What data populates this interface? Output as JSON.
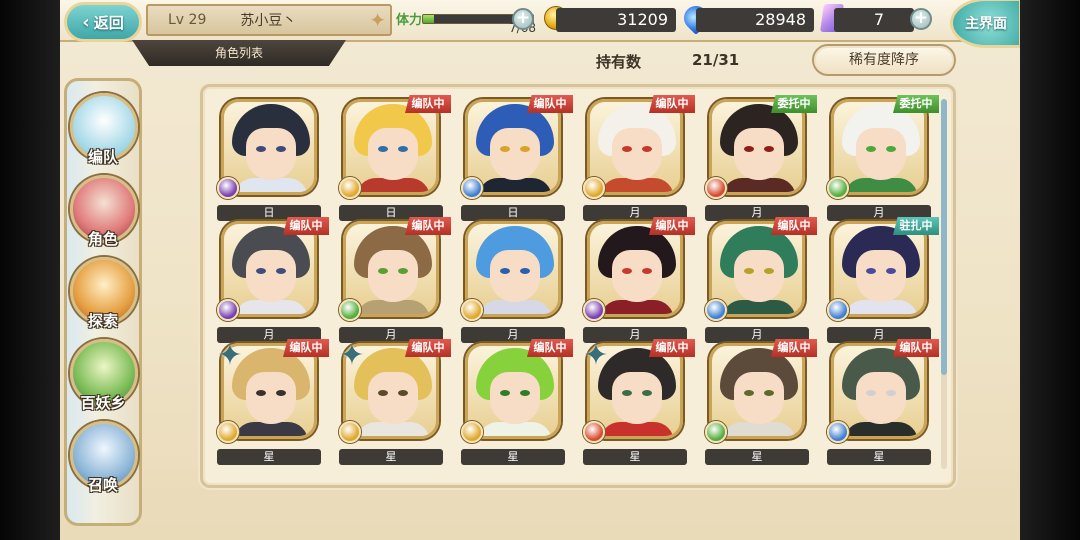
{
  "topbar": {
    "back_label": "返回",
    "level": "Lv 29",
    "player_name": "苏小豆丶",
    "stamina_label": "体力",
    "stamina_value": "7/68",
    "stamina_fraction": 0.103,
    "gold": "31209",
    "jade": "28948",
    "gems": "7",
    "main_label": "主界面"
  },
  "header": {
    "list_title": "角色列表",
    "owned_label": "持有数",
    "owned_count": "21/31",
    "sort_label": "稀有度降序"
  },
  "rail": [
    {
      "label": "编队",
      "icon": "ghost-team-icon"
    },
    {
      "label": "角色",
      "icon": "character-icon"
    },
    {
      "label": "探索",
      "icon": "map-scroll-icon"
    },
    {
      "label": "百妖乡",
      "icon": "village-icon"
    },
    {
      "label": "召唤",
      "icon": "summon-swirl-icon"
    }
  ],
  "cards": [
    {
      "label": "日",
      "status": "",
      "hair": "#2a2f3d",
      "body": "#dfe6ef",
      "eye": "#3b4a79",
      "elem": "#7a3fb0",
      "star": false
    },
    {
      "label": "日",
      "status": "编队中",
      "hair": "#f2c84b",
      "body": "#b83a2c",
      "eye": "#2f6ea8",
      "elem": "#e0a82a",
      "star": false
    },
    {
      "label": "日",
      "status": "编队中",
      "hair": "#2e5db7",
      "body": "#1e2633",
      "eye": "#d9a32b",
      "elem": "#3f7fd1",
      "star": false
    },
    {
      "label": "月",
      "status": "编队中",
      "hair": "#f4f1ea",
      "body": "#c44b2e",
      "eye": "#c5392b",
      "elem": "#e0a82a",
      "star": false
    },
    {
      "label": "月",
      "status": "委托中",
      "hair": "#2b2420",
      "body": "#5a2a24",
      "eye": "#8e1e1a",
      "elem": "#d8492d",
      "star": false
    },
    {
      "label": "月",
      "status": "委托中",
      "hair": "#f2f2ee",
      "body": "#3f8c45",
      "eye": "#4ca83c",
      "elem": "#53ad3b",
      "star": false
    },
    {
      "label": "月",
      "status": "编队中",
      "hair": "#4a4c52",
      "body": "#e6e6ea",
      "eye": "#3d4f7a",
      "elem": "#7a3fb0",
      "star": false
    },
    {
      "label": "月",
      "status": "编队中",
      "hair": "#8b6a45",
      "body": "#b7a173",
      "eye": "#5a9e34",
      "elem": "#53ad3b",
      "star": false
    },
    {
      "label": "月",
      "status": "",
      "hair": "#4f9be0",
      "body": "#d6d8e6",
      "eye": "#2a5fae",
      "elem": "#e0a82a",
      "star": false
    },
    {
      "label": "月",
      "status": "编队中",
      "hair": "#23181c",
      "body": "#8a1f28",
      "eye": "#c43a2f",
      "elem": "#7a3fb0",
      "star": false
    },
    {
      "label": "月",
      "status": "编队中",
      "hair": "#2f7d5b",
      "body": "#2c5a44",
      "eye": "#b6a12d",
      "elem": "#3f7fd1",
      "star": false
    },
    {
      "label": "月",
      "status": "驻扎中",
      "hair": "#2b2a55",
      "body": "#e3e3ef",
      "eye": "#4c4a9e",
      "elem": "#3f7fd1",
      "star": false
    },
    {
      "label": "星",
      "status": "编队中",
      "hair": "#d9b56d",
      "body": "#3b3a44",
      "eye": "#3b3030",
      "elem": "#e0a82a",
      "star": true
    },
    {
      "label": "星",
      "status": "编队中",
      "hair": "#e3c05a",
      "body": "#e9e6df",
      "eye": "#5b4a2a",
      "elem": "#e0a82a",
      "star": true
    },
    {
      "label": "星",
      "status": "编队中",
      "hair": "#87d13c",
      "body": "#eef3e5",
      "eye": "#2e7d2b",
      "elem": "#e0a82a",
      "star": false
    },
    {
      "label": "星",
      "status": "编队中",
      "hair": "#2f2a2a",
      "body": "#c9312c",
      "eye": "#3b6e48",
      "elem": "#d8492d",
      "star": true
    },
    {
      "label": "星",
      "status": "编队中",
      "hair": "#5c4a3a",
      "body": "#e0dcd2",
      "eye": "#5d6a2d",
      "elem": "#53ad3b",
      "star": false
    },
    {
      "label": "星",
      "status": "编队中",
      "hair": "#4a5a4a",
      "body": "#2a2e2a",
      "eye": "#d0d0d0",
      "elem": "#3f7fd1",
      "star": false
    }
  ]
}
